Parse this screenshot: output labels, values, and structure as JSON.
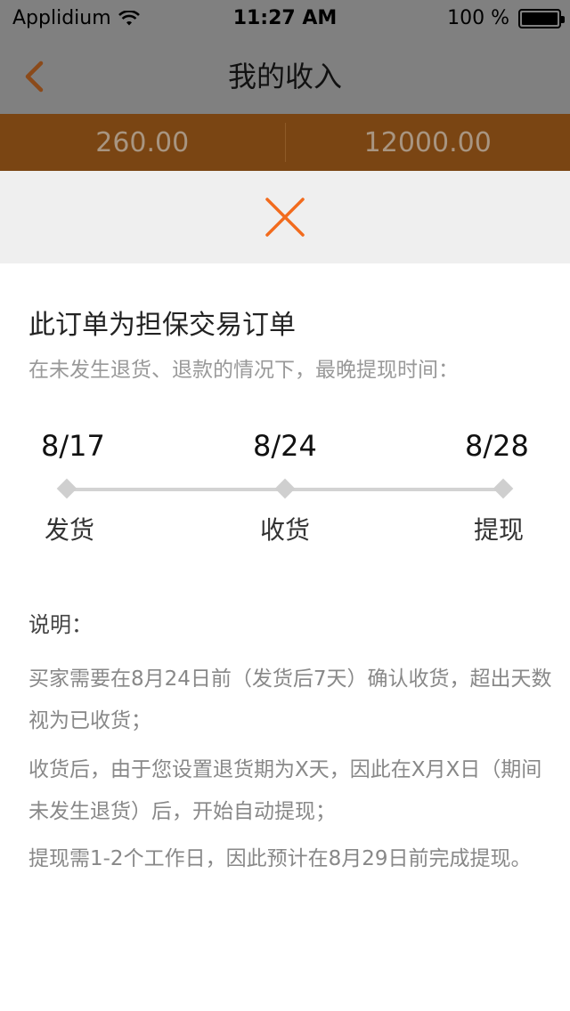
{
  "status_bar": {
    "carrier": "Applidium",
    "time": "11:27 AM",
    "battery": "100 %"
  },
  "nav": {
    "title": "我的收入",
    "back_icon": "chevron-left-icon"
  },
  "stats": {
    "left_value": "260.00",
    "right_value": "12000.00"
  },
  "modal": {
    "close_icon": "close-icon",
    "heading": "此订单为担保交易订单",
    "subheading": "在未发生退货、退款的情况下，最晚提现时间：",
    "timeline": [
      {
        "date": "8/17",
        "label": "发货"
      },
      {
        "date": "8/24",
        "label": "收货"
      },
      {
        "date": "8/28",
        "label": "提现"
      }
    ],
    "notes_title": "说明：",
    "notes": [
      "买家需要在8月24日前（发货后7天）确认收货，超出天数视为已收货；",
      "收货后，由于您设置退货期为X天，因此在X月X日（期间未发生退货）后，开始自动提现；",
      "提现需1-2个工作日，因此预计在8月29日前完成提现。"
    ]
  },
  "colors": {
    "accent": "#f26b1d",
    "stats_bg": "#7a4513",
    "overlay_gray": "#808080",
    "back_arrow": "#8b4a1a"
  }
}
